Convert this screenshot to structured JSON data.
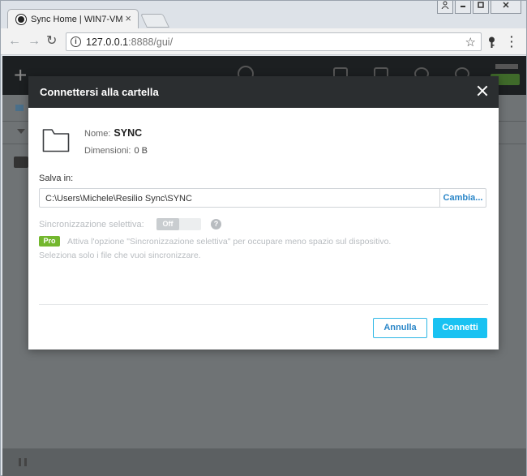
{
  "browser": {
    "tab_title": "Sync Home | WIN7-VM",
    "tab_close": "×",
    "url_host": "127.0.0.1",
    "url_rest": ":8888/gui/"
  },
  "modal": {
    "title": "Connettersi alla cartella",
    "name_label": "Nome:",
    "name_value": "SYNC",
    "size_label": "Dimensioni:",
    "size_value": "0 B",
    "save_label": "Salva in:",
    "path_value": "C:\\Users\\Michele\\Resilio Sync\\SYNC",
    "change_label": "Cambia...",
    "selective_label": "Sincronizzazione selettiva:",
    "toggle_label": "Off",
    "help": "?",
    "pro_tag": "Pro",
    "pro_text_1": "Attiva l'opzione \"Sincronizzazione selettiva\" per occupare meno spazio sul dispositivo.",
    "pro_text_2": "Seleziona solo i file che vuoi sincronizzare.",
    "cancel_label": "Annulla",
    "connect_label": "Connetti"
  },
  "colors": {
    "accent": "#19c2f2",
    "link": "#2a86c8",
    "pro": "#73b72e",
    "header": "#2b2e30"
  }
}
